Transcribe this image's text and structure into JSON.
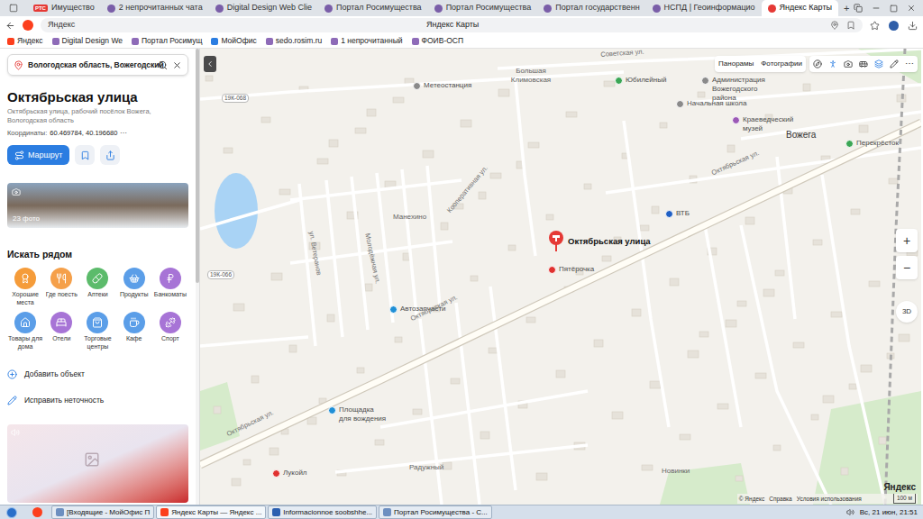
{
  "browser": {
    "tabs": [
      {
        "icon": "РТС",
        "label": "Имущество",
        "selected": false
      },
      {
        "label": "2 непрочитанных чата",
        "selected": false
      },
      {
        "label": "Digital Design Web Clie",
        "selected": false
      },
      {
        "label": "Портал Росимущества",
        "selected": false
      },
      {
        "label": "Портал Росимущества",
        "selected": false
      },
      {
        "label": "Портал государственн",
        "selected": false
      },
      {
        "label": "НСПД | Геоинформацио",
        "selected": false
      },
      {
        "label": "Яндекс Карты",
        "selected": true
      }
    ],
    "new_tab": "+",
    "address": "Яндекс",
    "page_title": "Яндекс Карты",
    "bookmarks": [
      "Яндекс",
      "Digital Design We",
      "Портал Росимущ",
      "МойОфис",
      "sedo.rosim.ru",
      "1 непрочитанный",
      "ФОИВ-ОСП"
    ]
  },
  "sidebar": {
    "search": {
      "value": "Вологодская область, Вожегодский"
    },
    "title": "Октябрьская улица",
    "address": "Октябрьская улица, рабочий посёлок Вожега, Вологодская область",
    "coords_label": "Координаты:",
    "coords": "60.469784, 40.196680",
    "more": "⋯",
    "route_button": "Маршрут",
    "photos": "23 фото",
    "nearby_title": "Искать рядом",
    "categories": [
      {
        "label": "Хорошие места",
        "color": "#f59c3a"
      },
      {
        "label": "Где поесть",
        "color": "#f5a04a"
      },
      {
        "label": "Аптеки",
        "color": "#5cbb6b"
      },
      {
        "label": "Продукты",
        "color": "#5b9ee8"
      },
      {
        "label": "Банкоматы",
        "color": "#a774d6"
      },
      {
        "label": "Товары для дома",
        "color": "#5b9ee8"
      },
      {
        "label": "Отели",
        "color": "#a774d6"
      },
      {
        "label": "Торговые центры",
        "color": "#5b9ee8"
      },
      {
        "label": "Кафе",
        "color": "#5b9ee8"
      },
      {
        "label": "Спорт",
        "color": "#a774d6"
      }
    ],
    "actions": [
      "Добавить объект",
      "Исправить неточность"
    ]
  },
  "map": {
    "pin": {
      "label": "Октябрьская улица"
    },
    "labels": [
      {
        "text": "Большая Климовская",
        "kind": "area"
      },
      {
        "text": "Советская ул.",
        "kind": "street"
      },
      {
        "text": "Метеостанция",
        "kind": "poi",
        "color": "#8a8a8a"
      },
      {
        "text": "Юбилейный",
        "kind": "poi",
        "color": "#3aa655"
      },
      {
        "text": "Администрация Вожегодского района",
        "kind": "poi",
        "color": "#8a8a8a"
      },
      {
        "text": "Начальная школа",
        "kind": "poi",
        "color": "#8a8a8a"
      },
      {
        "text": "Краеведческий музей",
        "kind": "poi",
        "color": "#9b59b6"
      },
      {
        "text": "Вожега",
        "kind": "settlement"
      },
      {
        "text": "Перекрёсток",
        "kind": "poi",
        "color": "#3aa655"
      },
      {
        "text": "ВТБ",
        "kind": "poi",
        "color": "#1f5fc4"
      },
      {
        "text": "Пятёрочка",
        "kind": "poi",
        "color": "#e0312f"
      },
      {
        "text": "Автозапчасти",
        "kind": "poi",
        "color": "#1f8fd6"
      },
      {
        "text": "Манехино",
        "kind": "area"
      },
      {
        "text": "Площадка для вождения",
        "kind": "poi",
        "color": "#1f8fd6"
      },
      {
        "text": "Лукойл",
        "kind": "poi",
        "color": "#e0312f"
      },
      {
        "text": "Радужный",
        "kind": "area"
      },
      {
        "text": "Новинки",
        "kind": "area"
      },
      {
        "text": "Октябрьская ул.",
        "kind": "street"
      },
      {
        "text": "Октябрьская ул.",
        "kind": "street"
      },
      {
        "text": "Октябрьская ул.",
        "kind": "street"
      },
      {
        "text": "ул. Ветеранов",
        "kind": "street"
      },
      {
        "text": "Молодёжная ул.",
        "kind": "street"
      },
      {
        "text": "Кооперативная ул.",
        "kind": "street"
      },
      {
        "text": "19К-068",
        "kind": "road_number"
      },
      {
        "text": "19К-066",
        "kind": "road_number"
      }
    ],
    "controls": {
      "panoramas": "Панорамы",
      "photos": "Фотографии",
      "more": "⋯",
      "zoom_in": "+",
      "zoom_out": "−",
      "three_d": "3D"
    },
    "attribution": {
      "copyright": "© Яндекс",
      "help": "Справка",
      "terms": "Условия использования",
      "scale": "100 м",
      "logo": "Яндекс"
    }
  },
  "taskbar": {
    "items": [
      {
        "label": "[Входящие - МойОфис П",
        "selected": false
      },
      {
        "label": "Яндекс Карты — Яндекс ...",
        "selected": true
      },
      {
        "label": "Informacionnoe soobshhe...",
        "selected": false
      },
      {
        "label": "Портал Росимущества - С...",
        "selected": false
      }
    ],
    "clock": "Вс, 21 июн, 21:51"
  }
}
